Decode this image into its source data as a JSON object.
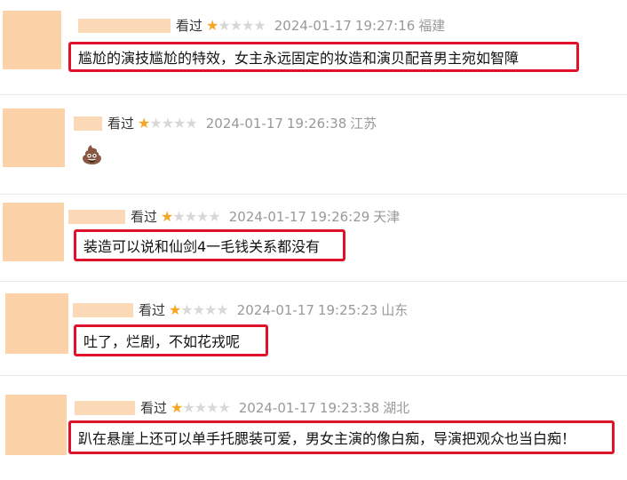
{
  "colors": {
    "highlight_border": "#e0112b",
    "star_on": "#f5a623",
    "star_off": "#d8d8d8",
    "avatar": "#fcd3a8"
  },
  "reviews": [
    {
      "status": "看过",
      "rating": 1,
      "max_rating": 5,
      "date": "2024-01-17",
      "time": "19:27:16",
      "location": "福建",
      "content": "尴尬的演技尴尬的特效，女主永远固定的妆造和演贝配音男主宛如智障"
    },
    {
      "status": "看过",
      "rating": 1,
      "max_rating": 5,
      "date": "2024-01-17",
      "time": "19:26:38",
      "location": "江苏",
      "content": "",
      "emoji": "💩",
      "emoji_name": "poop-emoji"
    },
    {
      "status": "看过",
      "rating": 1,
      "max_rating": 5,
      "date": "2024-01-17",
      "time": "19:26:29",
      "location": "天津",
      "content": "装造可以说和仙剑4一毛钱关系都没有"
    },
    {
      "status": "看过",
      "rating": 1,
      "max_rating": 5,
      "date": "2024-01-17",
      "time": "19:25:23",
      "location": "山东",
      "content": "吐了，烂剧，不如花戎呢"
    },
    {
      "status": "看过",
      "rating": 1,
      "max_rating": 5,
      "date": "2024-01-17",
      "time": "19:23:38",
      "location": "湖北",
      "content": "趴在悬崖上还可以单手托腮装可爱，男女主演的像白痴，导演把观众也当白痴！"
    }
  ]
}
